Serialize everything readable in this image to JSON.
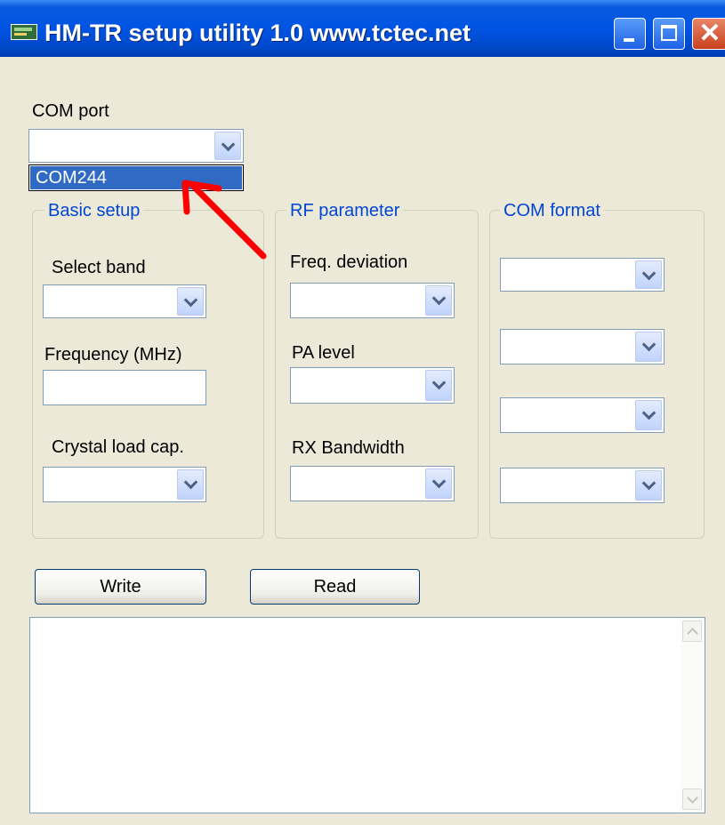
{
  "window": {
    "title": "HM-TR setup utility  1.0   www.tctec.net",
    "controls": {
      "minimize": "minimize-icon",
      "maximize": "maximize-icon",
      "close_glyph": "✕"
    }
  },
  "com_port": {
    "label": "COM port",
    "value": "",
    "dropdown_options": [
      "COM244"
    ],
    "highlighted_option": "COM244"
  },
  "basic_setup": {
    "title": "Basic setup",
    "select_band_label": "Select band",
    "frequency_label": "Frequency (MHz)",
    "frequency_value": "",
    "crystal_label": "Crystal load cap."
  },
  "rf_parameter": {
    "title": "RF parameter",
    "freq_deviation_label": "Freq. deviation",
    "pa_level_label": "PA level",
    "rx_bandwidth_label": "RX Bandwidth"
  },
  "com_format": {
    "title": "COM format"
  },
  "buttons": {
    "write": "Write",
    "read": "Read"
  },
  "log": {
    "content": ""
  },
  "colors": {
    "titlebar": "#0054e3",
    "window_bg": "#ece9d8",
    "selection": "#316ac5",
    "group_title": "#0046d5",
    "annotation_arrow": "#ff0000"
  }
}
